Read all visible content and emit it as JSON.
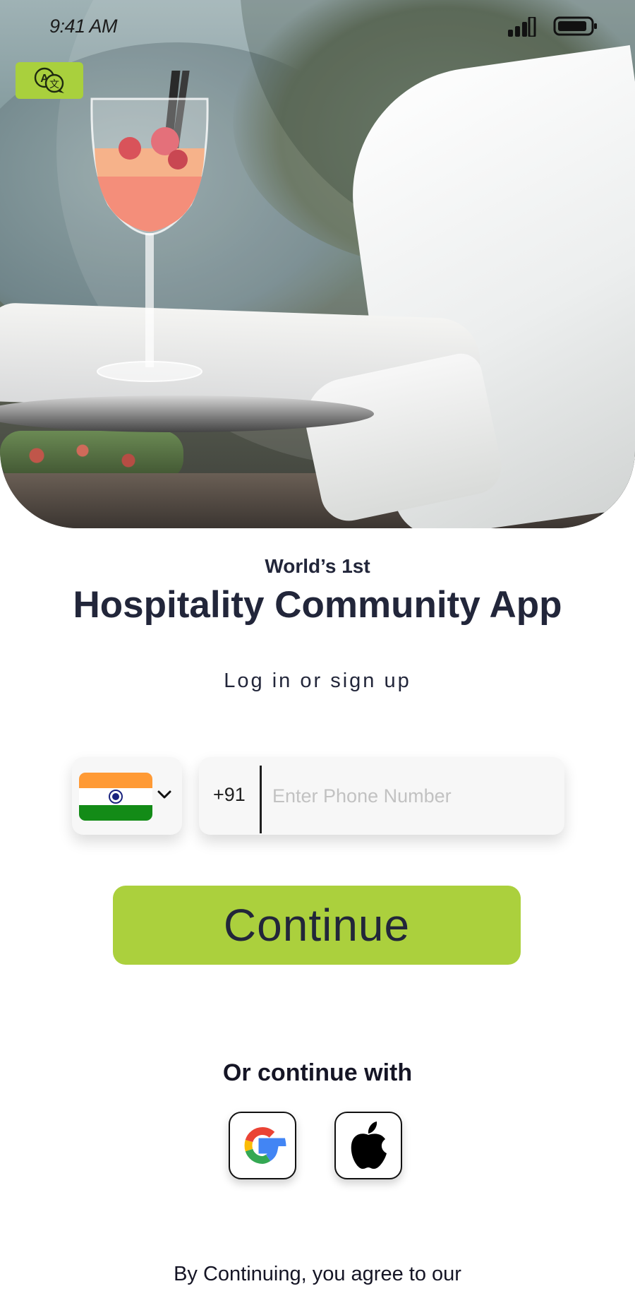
{
  "status_bar": {
    "time": "9:41 AM"
  },
  "hero": {
    "image": "waiter-with-cocktail-tray"
  },
  "language_button": {
    "icon": "translate-icon",
    "color": "#a9d03d"
  },
  "headline": {
    "subtitle": "World’s 1st",
    "title": "Hospitality Community App",
    "prompt": "Log in or sign up"
  },
  "phone_form": {
    "country": "India",
    "country_flag_icon": "india-flag-icon",
    "dial_code": "+91",
    "value": "",
    "placeholder": "Enter Phone Number"
  },
  "continue_button": {
    "label": "Continue",
    "color": "#abd03d"
  },
  "alt_login": {
    "label": "Or continue with",
    "providers": [
      {
        "name": "Google",
        "icon": "google-icon"
      },
      {
        "name": "Apple",
        "icon": "apple-icon"
      }
    ]
  },
  "terms_text": "By Continuing, you agree to our"
}
